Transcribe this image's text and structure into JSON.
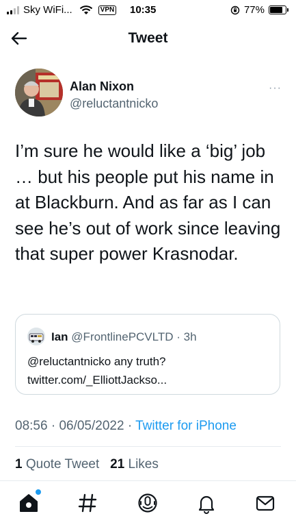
{
  "status_bar": {
    "carrier": "Sky WiFi...",
    "vpn": "VPN",
    "time": "10:35",
    "battery": "77%",
    "battery_level": 0.77
  },
  "header": {
    "title": "Tweet"
  },
  "tweet": {
    "author_name": "Alan Nixon",
    "author_handle": "@reluctantnicko",
    "more": "···",
    "text": "I’m sure he would like a ‘big’ job … but his people put his name in at Blackburn. And as far as I can see he’s out of work since leaving that super power Krasnodar.",
    "time": "08:56",
    "separator": "·",
    "date": "06/05/2022",
    "source": "Twitter for iPhone",
    "quote_count": "1",
    "quote_label": "Quote Tweet",
    "like_count": "21",
    "like_label": "Likes"
  },
  "quoted_tweet": {
    "name": "Ian",
    "handle": "@FrontlinePCVLTD",
    "age": "3h",
    "text_line1": "@reluctantnicko any truth?",
    "text_line2": "twitter.com/_ElliottJackso..."
  },
  "tabbar": {
    "items": [
      "home-icon",
      "explore-icon",
      "spaces-icon",
      "notifications-icon",
      "messages-icon"
    ],
    "accent": "#1d9bf0"
  }
}
